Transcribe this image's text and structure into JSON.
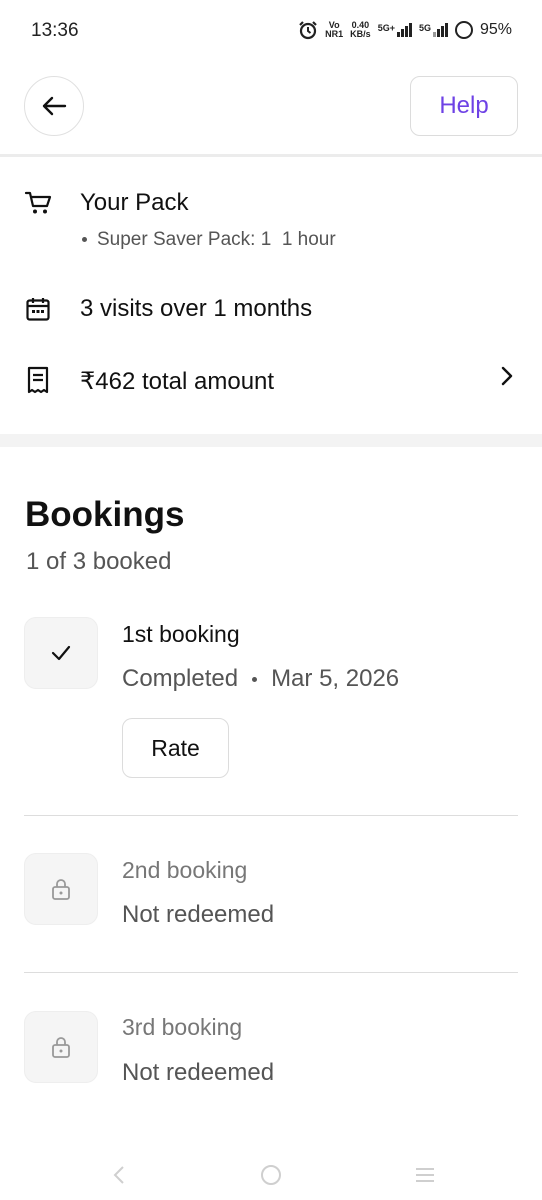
{
  "status_bar": {
    "time": "13:36",
    "volte_top": "Vo",
    "volte_bottom": "NR1",
    "speed_value": "0.40",
    "speed_unit": "KB/s",
    "sim1_label": "5G+",
    "sim2_label": "5G",
    "battery": "95%"
  },
  "header": {
    "back_icon": "arrow-left-icon",
    "help_label": "Help",
    "help_color": "#6e42e5"
  },
  "pack": {
    "title": "Your Pack",
    "item": "Super Saver Pack: 1  1 hour",
    "visits": "3 visits over 1 months",
    "amount": "₹462 total amount"
  },
  "bookings": {
    "title": "Bookings",
    "summary": "1 of 3 booked",
    "items": [
      {
        "title": "1st booking",
        "status": "Completed",
        "date": "Mar 5, 2026",
        "action": "Rate",
        "icon": "check-icon"
      },
      {
        "title": "2nd booking",
        "status": "Not redeemed",
        "icon": "lock-icon"
      },
      {
        "title": "3rd booking",
        "status": "Not redeemed",
        "icon": "lock-icon"
      }
    ]
  },
  "nav": {
    "back_icon": "nav-back-icon",
    "home_icon": "nav-home-icon",
    "recents_icon": "nav-recents-icon"
  }
}
